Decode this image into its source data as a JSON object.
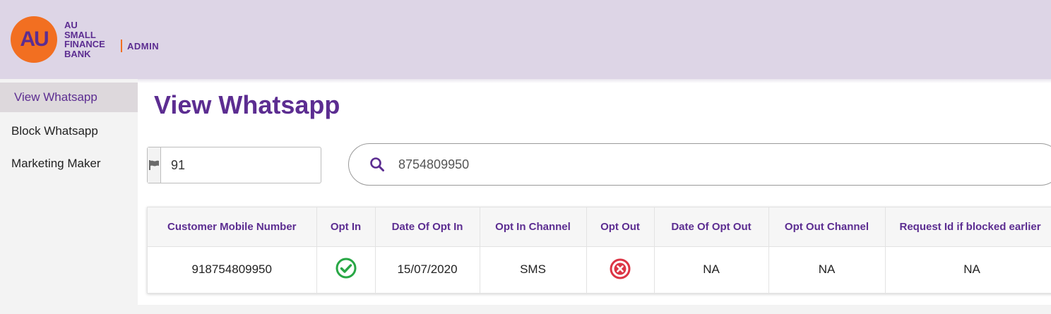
{
  "header": {
    "logo_mark": "AU",
    "logo_lines": [
      "AU",
      "SMALL",
      "FINANCE",
      "BANK"
    ],
    "admin_label": "ADMIN",
    "brand_orange": "#f26f21",
    "brand_purple": "#5c2d91"
  },
  "sidebar": {
    "items": [
      {
        "label": "View Whatsapp",
        "active": true
      },
      {
        "label": "Block Whatsapp",
        "active": false
      },
      {
        "label": "Marketing Maker",
        "active": false
      }
    ]
  },
  "page": {
    "title": "View Whatsapp"
  },
  "search": {
    "country_icon": "flag-icon",
    "country_code": "91",
    "search_icon": "search-icon",
    "mobile_value": "8754809950"
  },
  "table": {
    "headers": [
      "Customer Mobile Number",
      "Opt In",
      "Date Of Opt In",
      "Opt In Channel",
      "Opt Out",
      "Date Of Opt Out",
      "Opt Out Channel",
      "Request Id if blocked earlier"
    ],
    "rows": [
      {
        "mobile": "918754809950",
        "opt_in_icon": "check-circle-icon",
        "opt_in_color": "#28a745",
        "date_opt_in": "15/07/2020",
        "opt_in_channel": "SMS",
        "opt_out_icon": "x-circle-icon",
        "opt_out_color": "#dc3545",
        "date_opt_out": "NA",
        "opt_out_channel": "NA",
        "request_id": "NA"
      }
    ]
  }
}
